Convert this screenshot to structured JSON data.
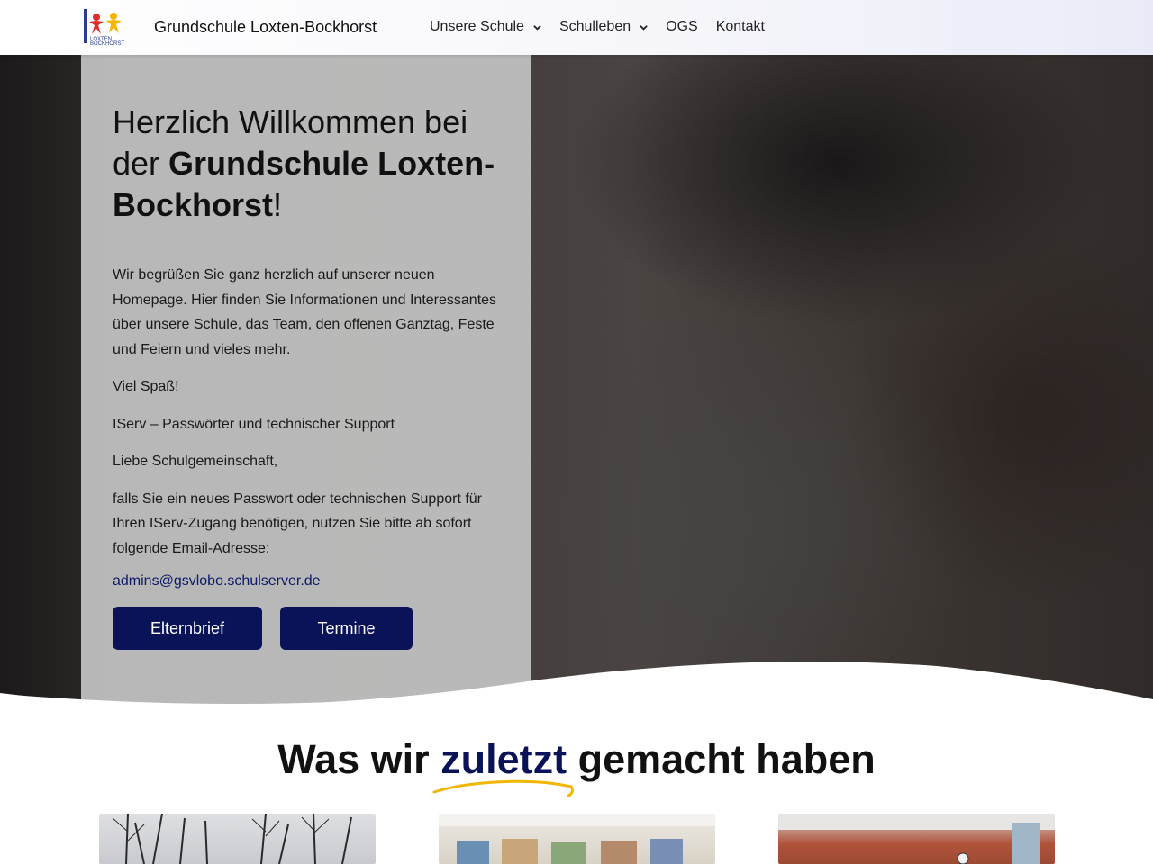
{
  "header": {
    "site_title": "Grundschule Loxten-Bockhorst",
    "nav": [
      {
        "label": "Unsere Schule",
        "has_dropdown": true
      },
      {
        "label": "Schulleben",
        "has_dropdown": true
      },
      {
        "label": "OGS",
        "has_dropdown": false
      },
      {
        "label": "Kontakt",
        "has_dropdown": false
      }
    ]
  },
  "hero": {
    "welcome_pre": "Herzlich Willkommen bei der ",
    "welcome_bold": "Grundschule Loxten-Bockhorst",
    "welcome_post": "!",
    "paragraphs": [
      "Wir begrüßen Sie ganz herzlich auf unserer neuen Homepage. Hier finden Sie Informationen und Interessantes über unsere Schule, das Team, den offenen Ganztag, Feste und Feiern und vieles mehr.",
      "Viel Spaß!",
      "IServ – Passwörter und technischer Support",
      "Liebe Schulgemeinschaft,",
      "falls Sie ein neues Passwort oder technischen Support für Ihren IServ-Zugang benötigen, nutzen Sie bitte ab sofort folgende Email-Adresse:"
    ],
    "email": "admins@gsvlobo.schulserver.de",
    "buttons": {
      "elternbrief": "Elternbrief",
      "termine": "Termine"
    }
  },
  "section": {
    "title_pre": "Was wir ",
    "title_accent": "zuletzt",
    "title_post": " gemacht haben"
  },
  "colors": {
    "accent": "#0b1358",
    "underline": "#f2b705",
    "panel": "#c3c3c3"
  }
}
